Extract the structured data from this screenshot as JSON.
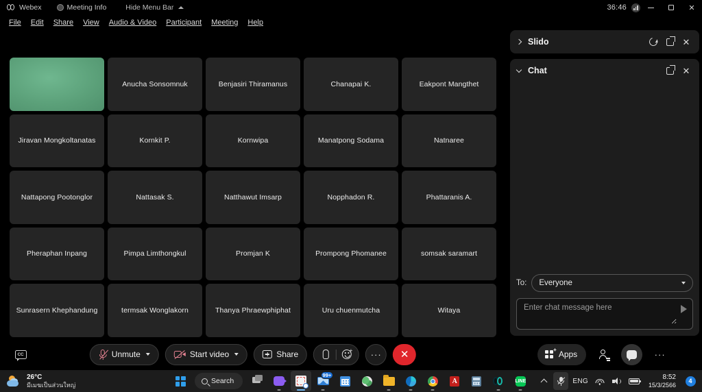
{
  "titlebar": {
    "app_name": "Webex",
    "meeting_info": "Meeting Info",
    "hide_menu_bar": "Hide Menu Bar",
    "timer": "36:46",
    "minimize": "–",
    "maximize": "□",
    "close": "✕"
  },
  "menubar": {
    "items": [
      {
        "label": "File"
      },
      {
        "label": "Edit"
      },
      {
        "label": "Share"
      },
      {
        "label": "View"
      },
      {
        "label": "Audio & Video"
      },
      {
        "label": "Participant"
      },
      {
        "label": "Meeting"
      },
      {
        "label": "Help"
      }
    ]
  },
  "grid": {
    "tiles": [
      {
        "name": "",
        "video": true
      },
      {
        "name": "Anucha Sonsomnuk",
        "video": false
      },
      {
        "name": "Benjasiri Thiramanus",
        "video": false
      },
      {
        "name": "Chanapai K.",
        "video": false
      },
      {
        "name": "Eakpont Mangthet",
        "video": false
      },
      {
        "name": "Jiravan Mongkoltanatas",
        "video": false
      },
      {
        "name": "Kornkit P.",
        "video": false
      },
      {
        "name": "Kornwipa",
        "video": false
      },
      {
        "name": "Manatpong Sodama",
        "video": false
      },
      {
        "name": "Natnaree",
        "video": false
      },
      {
        "name": "Nattapong Pootonglor",
        "video": false
      },
      {
        "name": "Nattasak S.",
        "video": false
      },
      {
        "name": "Natthawut Imsarp",
        "video": false
      },
      {
        "name": "Nopphadon R.",
        "video": false
      },
      {
        "name": "Phattaranis A.",
        "video": false
      },
      {
        "name": "Pheraphan Inpang",
        "video": false
      },
      {
        "name": "Pimpa Limthongkul",
        "video": false
      },
      {
        "name": "Promjan K",
        "video": false
      },
      {
        "name": "Prompong Phomanee",
        "video": false
      },
      {
        "name": "somsak saramart",
        "video": false
      },
      {
        "name": "Sunrasern Khephandung",
        "video": false
      },
      {
        "name": "termsak Wonglakorn",
        "video": false
      },
      {
        "name": "Thanya Phraewphiphat",
        "video": false
      },
      {
        "name": "Uru chuenmutcha",
        "video": false
      },
      {
        "name": "Witaya",
        "video": false
      }
    ]
  },
  "controls": {
    "cc": "CC",
    "unmute": "Unmute",
    "start_video": "Start video",
    "share": "Share",
    "more": "···",
    "leave": "✕",
    "apps": "Apps",
    "more_right": "···",
    "accent_red": "#e0262c",
    "muted_icon_color": "#e0808f"
  },
  "panels": {
    "slido": {
      "title": "Slido",
      "collapsed": true
    },
    "chat": {
      "title": "Chat",
      "collapsed": false,
      "to_label": "To:",
      "to_value": "Everyone",
      "input_placeholder": "Enter chat message here"
    }
  },
  "taskbar": {
    "weather": {
      "temp": "26°C",
      "condition": "มีเมฆเป็นส่วนใหญ่"
    },
    "search_label": "Search",
    "mail_badge": "99+",
    "adobe_glyph": "A",
    "line_glyph": "LINE",
    "language": "ENG",
    "time": "8:52",
    "date": "15/3/2566",
    "notification_count": "4"
  }
}
